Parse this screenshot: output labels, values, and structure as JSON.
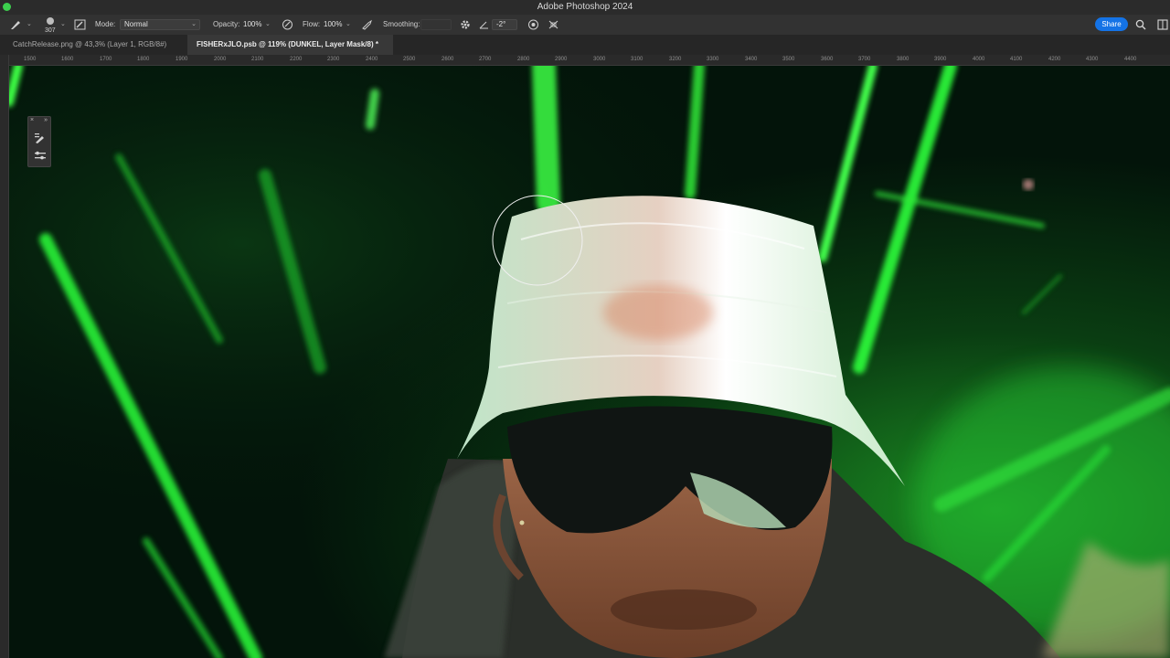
{
  "app": {
    "title": "Adobe Photoshop 2024"
  },
  "options_bar": {
    "brush_size": "307",
    "mode_label": "Mode:",
    "mode_value": "Normal",
    "opacity_label": "Opacity:",
    "opacity_value": "100%",
    "flow_label": "Flow:",
    "flow_value": "100%",
    "smoothing_label": "Smoothing:",
    "smoothing_value": "",
    "angle_value": "-2°",
    "share_label": "Share",
    "icons": [
      "brush-tool-icon",
      "brush-preset-icon",
      "brush-settings-icon",
      "pressure-opacity-icon",
      "airbrush-icon",
      "gear-icon",
      "angle-icon",
      "pressure-size-icon",
      "symmetry-icon",
      "search-icon",
      "workspace-icon"
    ]
  },
  "tabs": [
    {
      "label": "CatchRelease.png @ 43,3% (Layer 1, RGB/8#)",
      "active": false
    },
    {
      "label": "FISHERxJLO.psb @ 119% (DUNKEL, Layer Mask/8) *",
      "active": true
    }
  ],
  "ruler": {
    "top_ticks": [
      "1500",
      "1600",
      "1700",
      "1800",
      "1900",
      "2000",
      "2100",
      "2200",
      "2300",
      "2400",
      "2500",
      "2600",
      "2700",
      "2800",
      "2900",
      "3000",
      "3100",
      "3200",
      "3300",
      "3400",
      "3500",
      "3600",
      "3700",
      "3800",
      "3900",
      "4000",
      "4100",
      "4200",
      "4300",
      "4400"
    ]
  },
  "colors": {
    "accent": "#1473e6",
    "neon_green": "#2bff3a",
    "background_dark": "#041208"
  }
}
